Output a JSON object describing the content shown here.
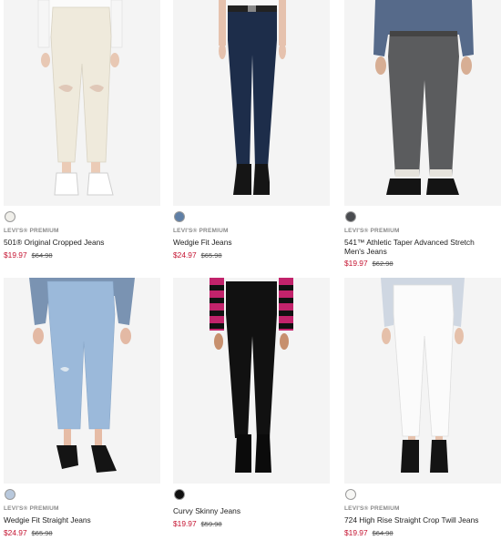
{
  "products": [
    {
      "brand": "LEVI'S® PREMIUM",
      "name": "501® Original Cropped Jeans",
      "sale_price": "$19.97",
      "original_price": "$64.98",
      "swatch_color": "#f0efea"
    },
    {
      "brand": "LEVI'S® PREMIUM",
      "name": "Wedgie Fit Jeans",
      "sale_price": "$24.97",
      "original_price": "$65.98",
      "swatch_color": "#5f7fa6"
    },
    {
      "brand": "LEVI'S® PREMIUM",
      "name": "541™ Athletic Taper Advanced Stretch",
      "name_line2": "Men's Jeans",
      "sale_price": "$19.97",
      "original_price": "$62.98",
      "swatch_color": "#4a4c50"
    },
    {
      "brand": "LEVI'S® PREMIUM",
      "name": "Wedgie Fit Straight Jeans",
      "sale_price": "$24.97",
      "original_price": "$65.98",
      "swatch_color": "#b8c8dc"
    },
    {
      "brand": "",
      "name": "Curvy Skinny Jeans",
      "sale_price": "$19.97",
      "original_price": "$59.98",
      "swatch_color": "#111111"
    },
    {
      "brand": "LEVI'S® PREMIUM",
      "name": "724 High Rise Straight Crop Twill Jeans",
      "sale_price": "$19.97",
      "original_price": "$64.98",
      "swatch_color": "#f7f7f5"
    }
  ]
}
